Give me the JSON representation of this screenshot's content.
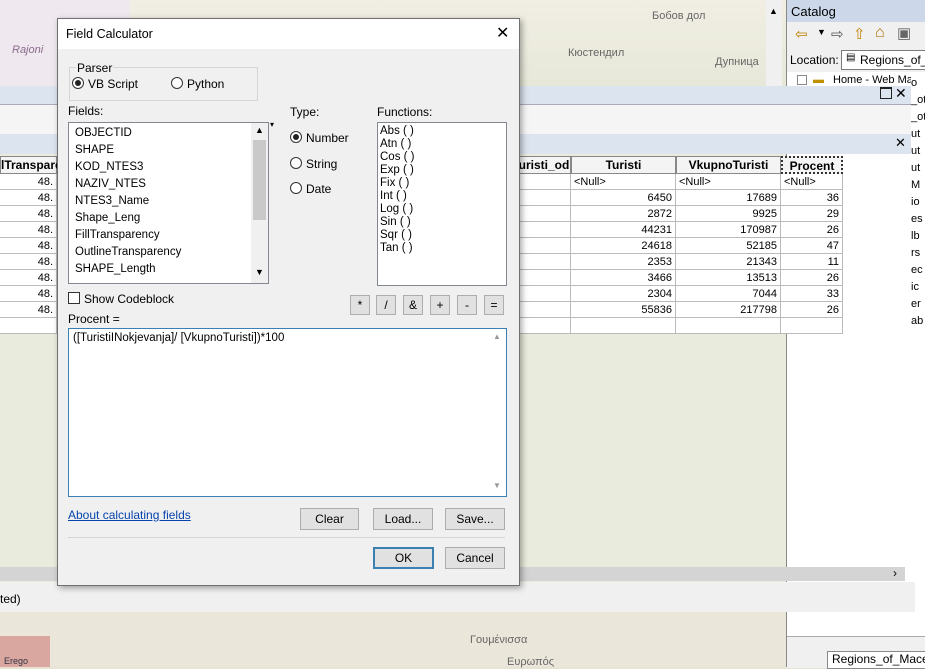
{
  "map": {
    "places": [
      "Бобов дол",
      "Кюстендил",
      "Дупница",
      "Rajoni",
      "Γουμένισσα",
      "Ευρωπός",
      "Erego"
    ]
  },
  "catalog": {
    "title": "Catalog",
    "location_label": "Location:",
    "location_value": "Regions_of_",
    "tree_item": "Home - Web Ma",
    "bottom_tab": "Regions_of_Mace"
  },
  "attribute_table": {
    "columns": [
      "lTranspare",
      "uristi_od",
      "Turisti",
      "VkupnoTuristi",
      "Procent"
    ],
    "rows": [
      [
        "48.",
        "",
        "<Null>",
        "<Null>",
        "<Null>"
      ],
      [
        "48.",
        "",
        "6450",
        "17689",
        "36"
      ],
      [
        "48.",
        "",
        "2872",
        "9925",
        "29"
      ],
      [
        "48.",
        "",
        "44231",
        "170987",
        "26"
      ],
      [
        "48.",
        "",
        "24618",
        "52185",
        "47"
      ],
      [
        "48.",
        "",
        "2353",
        "21343",
        "11"
      ],
      [
        "48.",
        "",
        "3466",
        "13513",
        "26"
      ],
      [
        "48.",
        "",
        "2304",
        "7044",
        "33"
      ],
      [
        "48.",
        "",
        "55836",
        "217798",
        "26"
      ],
      [
        "",
        "",
        "",
        "",
        ""
      ]
    ],
    "status_text": "ted)"
  },
  "dialog": {
    "title": "Field Calculator",
    "parser": {
      "label": "Parser",
      "options": [
        "VB Script",
        "Python"
      ],
      "selected": "VB Script"
    },
    "fields_label": "Fields:",
    "fields": [
      "OBJECTID",
      "SHAPE",
      "KOD_NTES3",
      "NAZIV_NTES",
      "NTES3_Name",
      "Shape_Leng",
      "FillTransparency",
      "OutlineTransparency",
      "SHAPE_Length"
    ],
    "type_label": "Type:",
    "types": [
      "Number",
      "String",
      "Date"
    ],
    "type_selected": "Number",
    "functions_label": "Functions:",
    "functions": [
      "Abs ( )",
      "Atn ( )",
      "Cos ( )",
      "Exp ( )",
      "Fix ( )",
      "Int ( )",
      "Log ( )",
      "Sin ( )",
      "Sqr ( )",
      "Tan ( )"
    ],
    "show_codeblock": "Show Codeblock",
    "operators": [
      "*",
      "/",
      "&",
      "+",
      "-",
      "="
    ],
    "expression_label": "Procent =",
    "expression": "([TuristiINokjevanja]/ [VkupnoTuristi])*100",
    "about_link": "About calculating fields",
    "clear": "Clear",
    "load": "Load...",
    "save": "Save...",
    "ok": "OK",
    "cancel": "Cancel"
  },
  "right_fragments": [
    "o",
    "_ot",
    "_ot",
    "ut",
    "ut",
    "ut",
    "M",
    "io",
    "es",
    "lb",
    "rs",
    "ec",
    "ic",
    "er",
    "ab"
  ]
}
